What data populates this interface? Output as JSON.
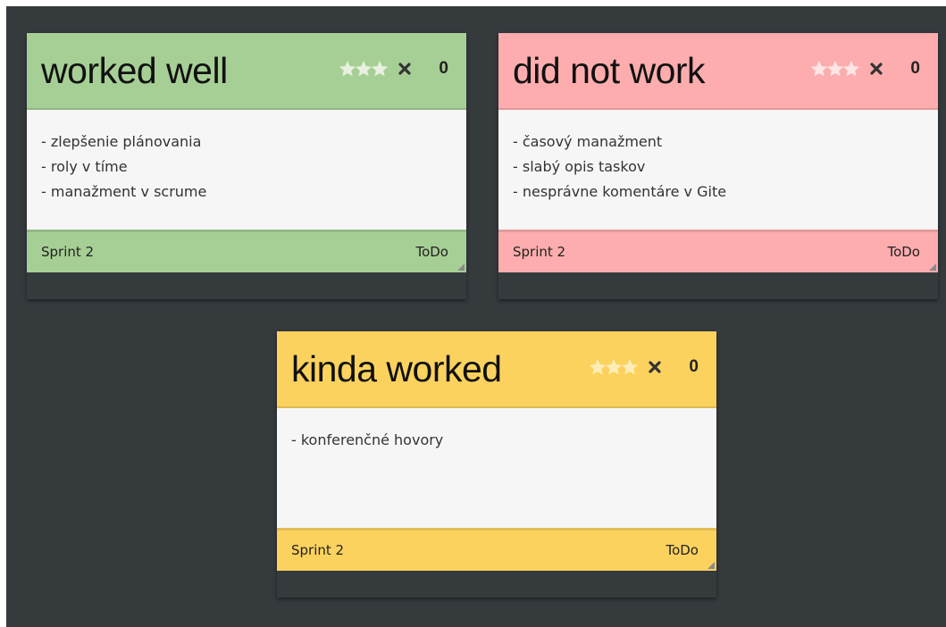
{
  "colors": {
    "board_background": "#353a3d",
    "card_body": "#f6f6f6",
    "green": "#a6cf95",
    "pink": "#fdadae",
    "yellow": "#fcd25f"
  },
  "cards": [
    {
      "title": "worked well",
      "rating": "0",
      "lines": [
        "- zlepšenie plánovania",
        "- roly v tíme",
        "- manažment v scrume"
      ],
      "sprint": "Sprint 2",
      "status": "ToDo",
      "color": "green",
      "icons": [
        "star-icon",
        "star-icon",
        "star-icon",
        "close-icon",
        "resize-handle-icon"
      ]
    },
    {
      "title": "did not work",
      "rating": "0",
      "lines": [
        "- časový manažment",
        "- slabý opis taskov",
        "- nesprávne komentáre v Gite"
      ],
      "sprint": "Sprint 2",
      "status": "ToDo",
      "color": "pink",
      "icons": [
        "star-icon",
        "star-icon",
        "star-icon",
        "close-icon",
        "resize-handle-icon"
      ]
    },
    {
      "title": "kinda worked",
      "rating": "0",
      "lines": [
        "- konferenčné hovory"
      ],
      "sprint": "Sprint 2",
      "status": "ToDo",
      "color": "yellow",
      "icons": [
        "star-icon",
        "star-icon",
        "star-icon",
        "close-icon",
        "resize-handle-icon"
      ]
    }
  ]
}
